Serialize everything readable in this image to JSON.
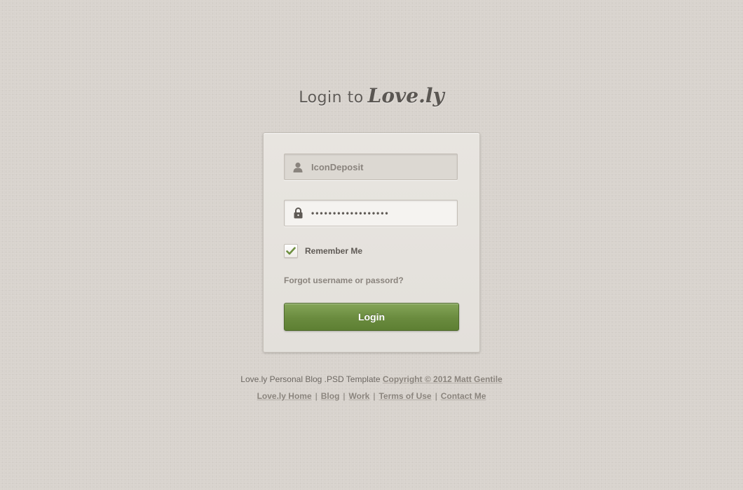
{
  "header": {
    "title_prefix": "Login to",
    "brand": "Love.ly"
  },
  "form": {
    "username_value": "IconDeposit",
    "password_value": "••••••••••••••••••",
    "remember_label": "Remember Me",
    "remember_checked": true,
    "forgot_link": "Forgot username or passord?",
    "login_button": "Login",
    "icons": {
      "username": "user-icon",
      "password": "lock-icon",
      "checkbox": "checkmark-icon"
    }
  },
  "footer": {
    "template_text": "Love.ly Personal Blog .PSD Template",
    "copyright_link": "Copyright © 2012 Matt Gentile",
    "links": [
      "Love.ly Home",
      "Blog",
      "Work",
      "Terms of Use",
      "Contact Me"
    ],
    "separator": "|"
  },
  "colors": {
    "background": "#d8d3cd",
    "card": "#e6e3de",
    "button_green": "#6a8b3e",
    "check_green": "#6d8e3f",
    "text_dark": "#5f5a55",
    "text_muted": "#8a847d"
  }
}
